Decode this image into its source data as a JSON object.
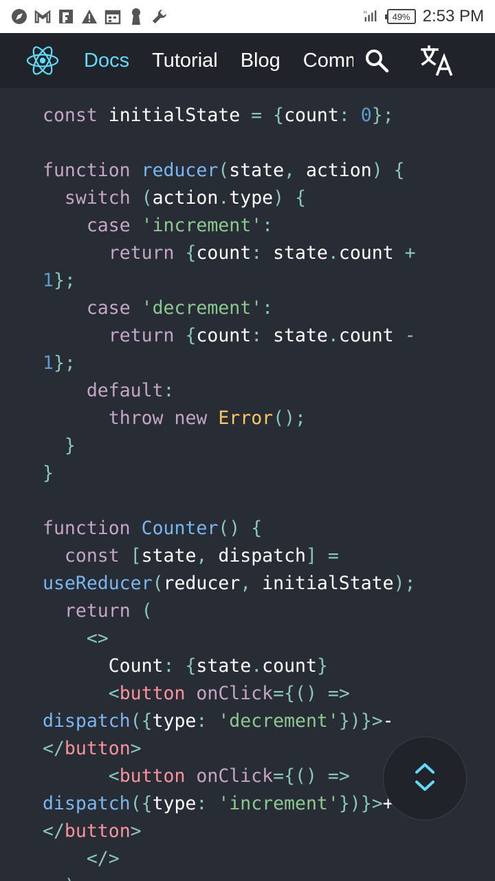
{
  "status_bar": {
    "time": "2:53 PM",
    "battery": "49%",
    "icons": [
      "compass-icon",
      "gmail-icon",
      "flipboard-icon",
      "warning-icon",
      "calendar-icon",
      "keyhole-icon",
      "wrench-icon",
      "signal-icon",
      "battery-icon"
    ]
  },
  "nav": {
    "links": [
      "Docs",
      "Tutorial",
      "Blog",
      "Community"
    ],
    "active": "Docs",
    "icons": [
      "react-logo-icon",
      "search-icon",
      "translate-icon"
    ]
  },
  "code_lines": [
    [
      [
        "kw",
        "const"
      ],
      [
        "plain",
        " initialState "
      ],
      [
        "pun",
        "="
      ],
      [
        "plain",
        " "
      ],
      [
        "pun",
        "{"
      ],
      [
        "plain",
        "count"
      ],
      [
        "pun",
        ":"
      ],
      [
        "plain",
        " "
      ],
      [
        "num",
        "0"
      ],
      [
        "pun",
        "};"
      ]
    ],
    [],
    [
      [
        "kw",
        "function"
      ],
      [
        "plain",
        " "
      ],
      [
        "fn",
        "reducer"
      ],
      [
        "pun",
        "("
      ],
      [
        "plain",
        "state"
      ],
      [
        "pun",
        ","
      ],
      [
        "plain",
        " action"
      ],
      [
        "pun",
        ")"
      ],
      [
        "plain",
        " "
      ],
      [
        "pun",
        "{"
      ]
    ],
    [
      [
        "plain",
        "  "
      ],
      [
        "kw",
        "switch"
      ],
      [
        "plain",
        " "
      ],
      [
        "pun",
        "("
      ],
      [
        "plain",
        "action"
      ],
      [
        "pun",
        "."
      ],
      [
        "plain",
        "type"
      ],
      [
        "pun",
        ")"
      ],
      [
        "plain",
        " "
      ],
      [
        "pun",
        "{"
      ]
    ],
    [
      [
        "plain",
        "    "
      ],
      [
        "kw",
        "case"
      ],
      [
        "plain",
        " "
      ],
      [
        "str",
        "'increment'"
      ],
      [
        "pun",
        ":"
      ]
    ],
    [
      [
        "plain",
        "      "
      ],
      [
        "kw",
        "return"
      ],
      [
        "plain",
        " "
      ],
      [
        "pun",
        "{"
      ],
      [
        "plain",
        "count"
      ],
      [
        "pun",
        ":"
      ],
      [
        "plain",
        " state"
      ],
      [
        "pun",
        "."
      ],
      [
        "plain",
        "count "
      ],
      [
        "pun",
        "+"
      ]
    ],
    [
      [
        "num",
        "1"
      ],
      [
        "pun",
        "};"
      ]
    ],
    [
      [
        "plain",
        "    "
      ],
      [
        "kw",
        "case"
      ],
      [
        "plain",
        " "
      ],
      [
        "str",
        "'decrement'"
      ],
      [
        "pun",
        ":"
      ]
    ],
    [
      [
        "plain",
        "      "
      ],
      [
        "kw",
        "return"
      ],
      [
        "plain",
        " "
      ],
      [
        "pun",
        "{"
      ],
      [
        "plain",
        "count"
      ],
      [
        "pun",
        ":"
      ],
      [
        "plain",
        " state"
      ],
      [
        "pun",
        "."
      ],
      [
        "plain",
        "count "
      ],
      [
        "pun",
        "-"
      ]
    ],
    [
      [
        "num",
        "1"
      ],
      [
        "pun",
        "};"
      ]
    ],
    [
      [
        "plain",
        "    "
      ],
      [
        "kw",
        "default"
      ],
      [
        "pun",
        ":"
      ]
    ],
    [
      [
        "plain",
        "      "
      ],
      [
        "kw",
        "throw"
      ],
      [
        "plain",
        " "
      ],
      [
        "kw",
        "new"
      ],
      [
        "plain",
        " "
      ],
      [
        "cls",
        "Error"
      ],
      [
        "pun",
        "();"
      ]
    ],
    [
      [
        "plain",
        "  "
      ],
      [
        "pun",
        "}"
      ]
    ],
    [
      [
        "pun",
        "}"
      ]
    ],
    [],
    [
      [
        "kw",
        "function"
      ],
      [
        "plain",
        " "
      ],
      [
        "fn",
        "Counter"
      ],
      [
        "pun",
        "()"
      ],
      [
        "plain",
        " "
      ],
      [
        "pun",
        "{"
      ]
    ],
    [
      [
        "plain",
        "  "
      ],
      [
        "kw",
        "const"
      ],
      [
        "plain",
        " "
      ],
      [
        "pun",
        "["
      ],
      [
        "plain",
        "state"
      ],
      [
        "pun",
        ","
      ],
      [
        "plain",
        " dispatch"
      ],
      [
        "pun",
        "]"
      ],
      [
        "plain",
        " "
      ],
      [
        "pun",
        "="
      ]
    ],
    [
      [
        "fn",
        "useReducer"
      ],
      [
        "pun",
        "("
      ],
      [
        "plain",
        "reducer"
      ],
      [
        "pun",
        ","
      ],
      [
        "plain",
        " initialState"
      ],
      [
        "pun",
        ");"
      ]
    ],
    [
      [
        "plain",
        "  "
      ],
      [
        "kw",
        "return"
      ],
      [
        "plain",
        " "
      ],
      [
        "pun",
        "("
      ]
    ],
    [
      [
        "plain",
        "    "
      ],
      [
        "pun",
        "<>"
      ]
    ],
    [
      [
        "plain",
        "      Count"
      ],
      [
        "pun",
        ":"
      ],
      [
        "plain",
        " "
      ],
      [
        "pun",
        "{"
      ],
      [
        "plain",
        "state"
      ],
      [
        "pun",
        "."
      ],
      [
        "plain",
        "count"
      ],
      [
        "pun",
        "}"
      ]
    ],
    [
      [
        "plain",
        "      "
      ],
      [
        "pun",
        "<"
      ],
      [
        "tag",
        "button"
      ],
      [
        "plain",
        " "
      ],
      [
        "attr",
        "onClick"
      ],
      [
        "pun",
        "={()"
      ],
      [
        "plain",
        " "
      ],
      [
        "pun",
        "=>"
      ]
    ],
    [
      [
        "fn",
        "dispatch"
      ],
      [
        "pun",
        "({"
      ],
      [
        "plain",
        "type"
      ],
      [
        "pun",
        ":"
      ],
      [
        "plain",
        " "
      ],
      [
        "str",
        "'decrement'"
      ],
      [
        "pun",
        "})}>"
      ],
      [
        "plain",
        "-"
      ]
    ],
    [
      [
        "pun",
        "</"
      ],
      [
        "tag",
        "button"
      ],
      [
        "pun",
        ">"
      ]
    ],
    [
      [
        "plain",
        "      "
      ],
      [
        "pun",
        "<"
      ],
      [
        "tag",
        "button"
      ],
      [
        "plain",
        " "
      ],
      [
        "attr",
        "onClick"
      ],
      [
        "pun",
        "={()"
      ],
      [
        "plain",
        " "
      ],
      [
        "pun",
        "=>"
      ]
    ],
    [
      [
        "fn",
        "dispatch"
      ],
      [
        "pun",
        "({"
      ],
      [
        "plain",
        "type"
      ],
      [
        "pun",
        ":"
      ],
      [
        "plain",
        " "
      ],
      [
        "str",
        "'increment'"
      ],
      [
        "pun",
        "})}>"
      ],
      [
        "plain",
        "+"
      ]
    ],
    [
      [
        "pun",
        "</"
      ],
      [
        "tag",
        "button"
      ],
      [
        "pun",
        ">"
      ]
    ],
    [
      [
        "plain",
        "    "
      ],
      [
        "pun",
        "</>"
      ]
    ],
    [
      [
        "plain",
        "  "
      ],
      [
        "pun",
        ");"
      ]
    ]
  ],
  "colors": {
    "background": "#282c34",
    "header": "#20232a",
    "accent": "#61dafb"
  },
  "fab": {
    "icon": "scroll-up-down-icon"
  }
}
